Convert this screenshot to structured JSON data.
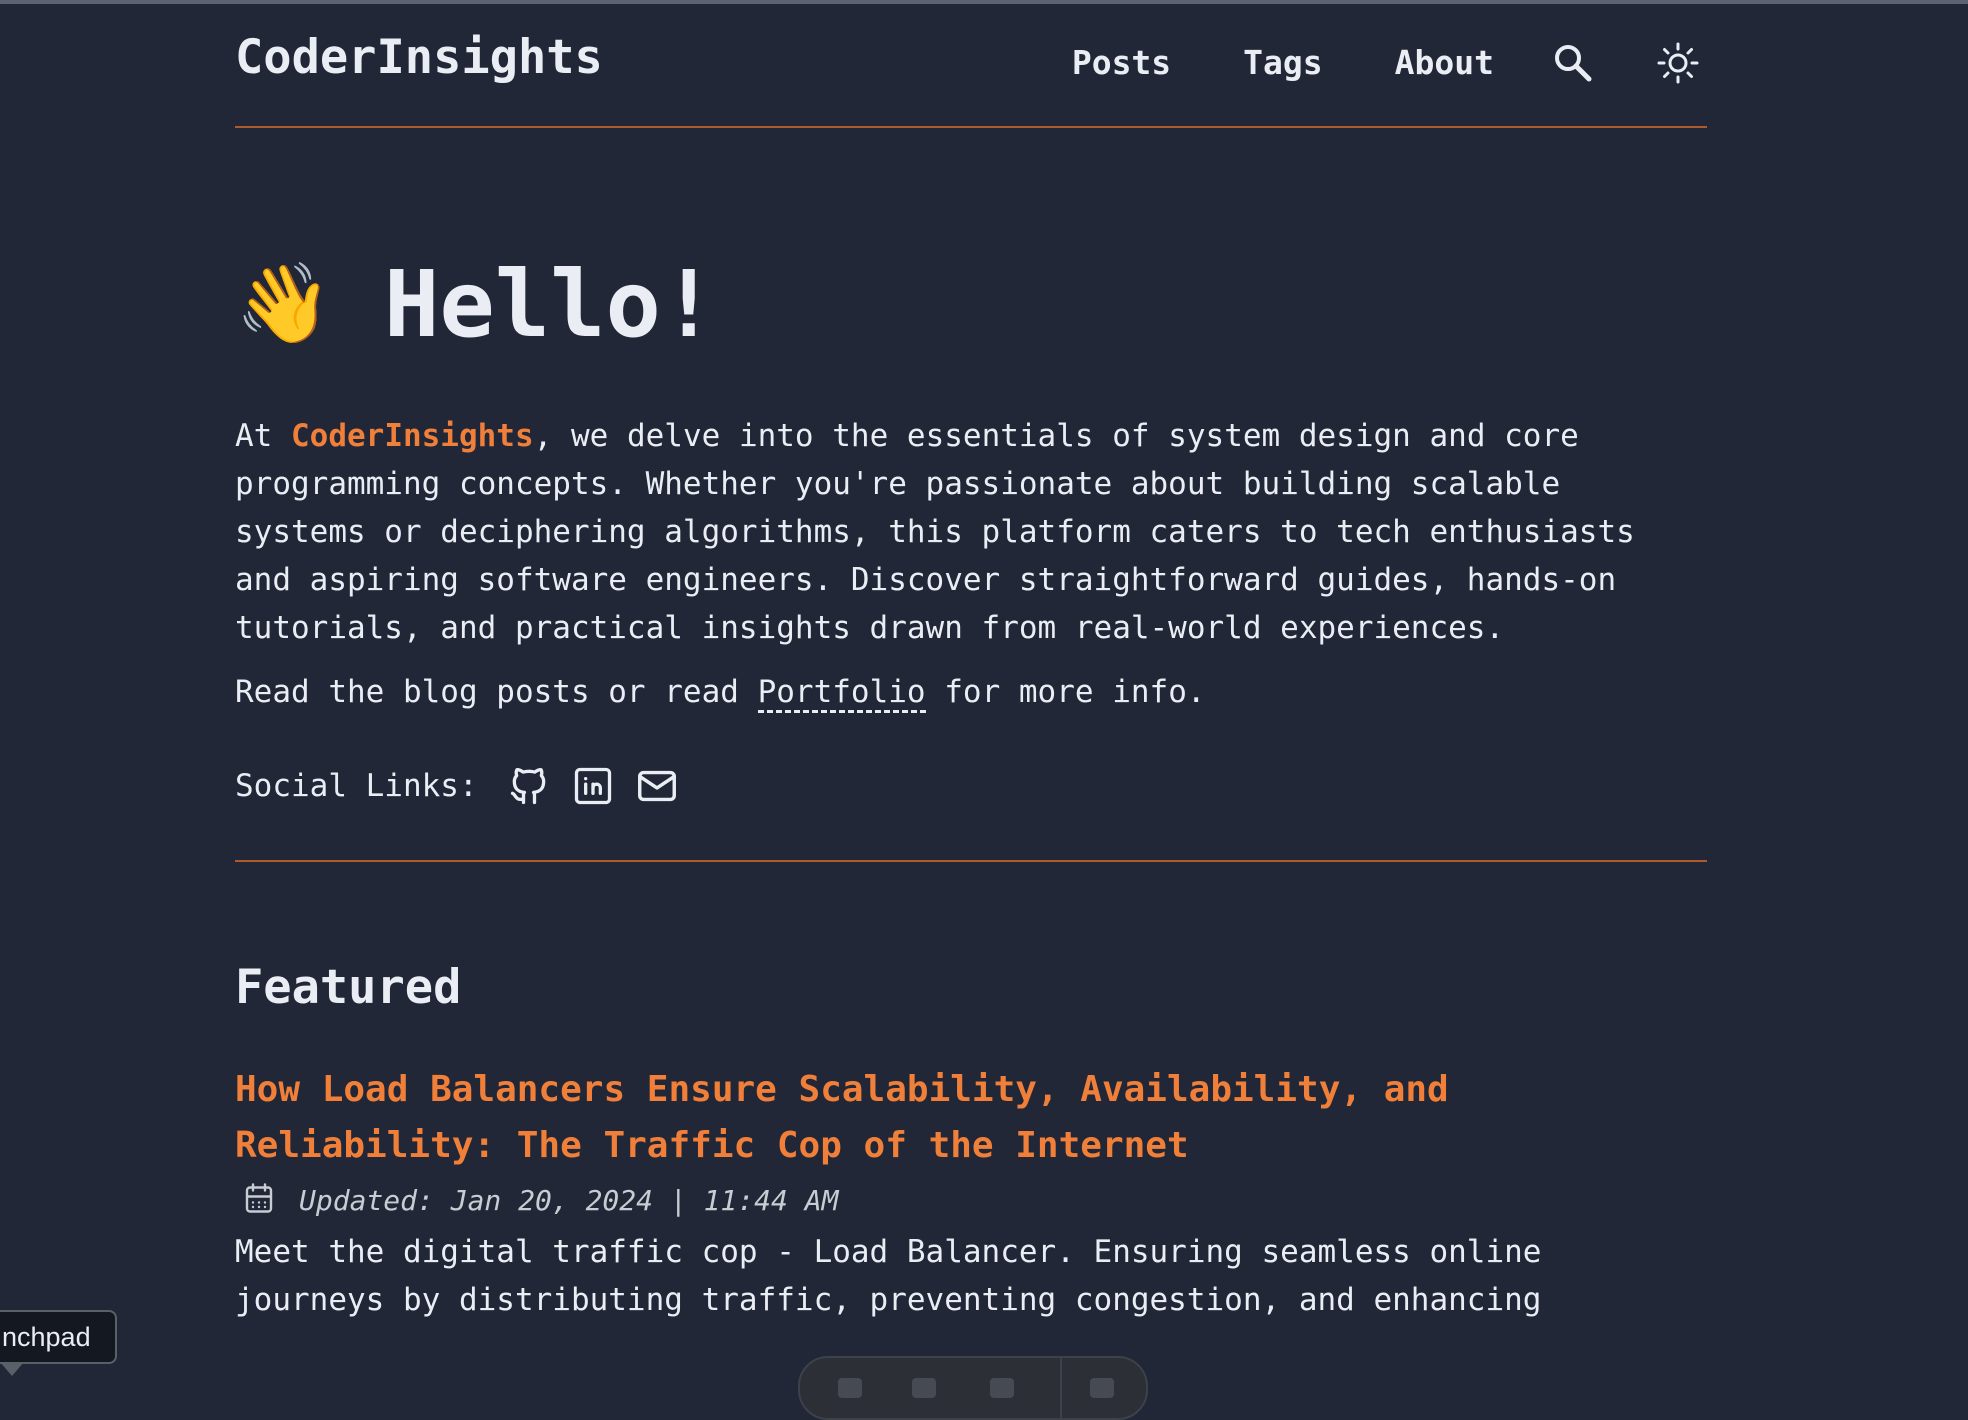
{
  "header": {
    "logo": "CoderInsights",
    "nav": [
      "Posts",
      "Tags",
      "About"
    ],
    "icons": [
      "search-icon",
      "sun-icon"
    ]
  },
  "hero": {
    "emoji": "👋",
    "title": "Hello!",
    "intro_prefix": "At ",
    "brand": "CoderInsights",
    "intro_rest": ", we delve into the essentials of system design and core programming concepts. Whether you're passionate about building scalable systems or deciphering algorithms, this platform caters to tech enthusiasts and aspiring software engineers. Discover straightforward guides, hands-on tutorials, and practical insights drawn from real-world experiences.",
    "read_prefix": "Read the blog posts or read ",
    "portfolio_link": "Portfolio",
    "read_suffix": " for more info.",
    "social_label": "Social Links:",
    "social_icons": [
      "github-icon",
      "linkedin-icon",
      "mail-icon"
    ]
  },
  "featured": {
    "heading": "Featured",
    "posts": [
      {
        "title": "How Load Balancers Ensure Scalability, Availability, and Reliability: The Traffic Cop of the Internet",
        "date": "Updated: Jan 20, 2024 | 11:44 AM",
        "description": "Meet the digital traffic cop - Load Balancer. Ensuring seamless online journeys by distributing traffic, preventing congestion, and enhancing"
      }
    ]
  },
  "overlay": {
    "tooltip": "nchpad"
  },
  "colors": {
    "background": "#212737",
    "accent": "#f07f3a",
    "text": "#eaedf3"
  }
}
